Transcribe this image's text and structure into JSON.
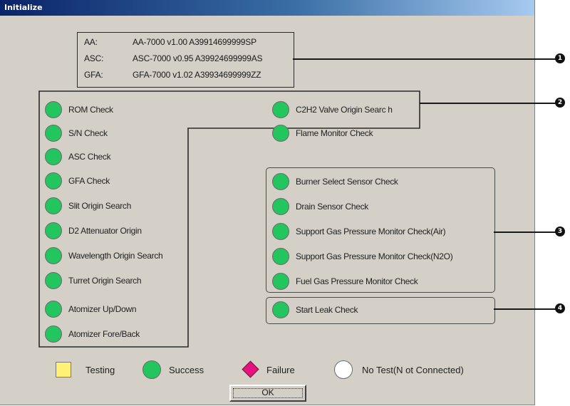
{
  "window": {
    "title": "Initialize"
  },
  "versions": [
    {
      "label": "AA:",
      "value": "AA-7000 v1.00 A39914699999SP"
    },
    {
      "label": "ASC:",
      "value": "ASC-7000 v0.95 A39924699999AS"
    },
    {
      "label": "GFA:",
      "value": "GFA-7000 v1.02 A39934699999ZZ"
    }
  ],
  "left_checks": [
    {
      "label": "ROM Check",
      "status": "success"
    },
    {
      "label": "S/N Check",
      "status": "success"
    },
    {
      "label": "ASC Check",
      "status": "success"
    },
    {
      "label": "GFA Check",
      "status": "success"
    },
    {
      "label": "Slit Origin Search",
      "status": "success"
    },
    {
      "label": "D2 Attenuator Origin",
      "status": "success"
    },
    {
      "label": "Wavelength Origin Search",
      "status": "success"
    },
    {
      "label": "Turret Origin Search",
      "status": "success"
    },
    {
      "label": "Atomizer Up/Down",
      "status": "success"
    },
    {
      "label": "Atomizer Fore/Back",
      "status": "success"
    }
  ],
  "right_top_checks": [
    {
      "label": "C2H2 Valve Origin Searc h",
      "status": "success"
    },
    {
      "label": "Flame Monitor Check",
      "status": "success"
    }
  ],
  "sensor_checks": [
    {
      "label": "Burner Select Sensor Check",
      "status": "success"
    },
    {
      "label": "Drain Sensor Check",
      "status": "success"
    },
    {
      "label": "Support Gas Pressure Monitor Check(Air)",
      "status": "success"
    },
    {
      "label": "Support Gas Pressure Monitor Check(N2O)",
      "status": "success"
    },
    {
      "label": "Fuel Gas Pressure Monitor Check",
      "status": "success"
    }
  ],
  "leak_check": {
    "label": "Start Leak Check",
    "status": "success"
  },
  "callouts": [
    "1",
    "2",
    "3",
    "4"
  ],
  "legend": {
    "testing": "Testing",
    "success": "Success",
    "failure": "Failure",
    "no_test": "No Test(N ot Connected)"
  },
  "ok_label": "OK",
  "colors": {
    "success": "#22c55e",
    "testing": "#fff176",
    "failure": "#e8127f",
    "no_test": "#ffffff",
    "titlebar": "#0a246a"
  }
}
